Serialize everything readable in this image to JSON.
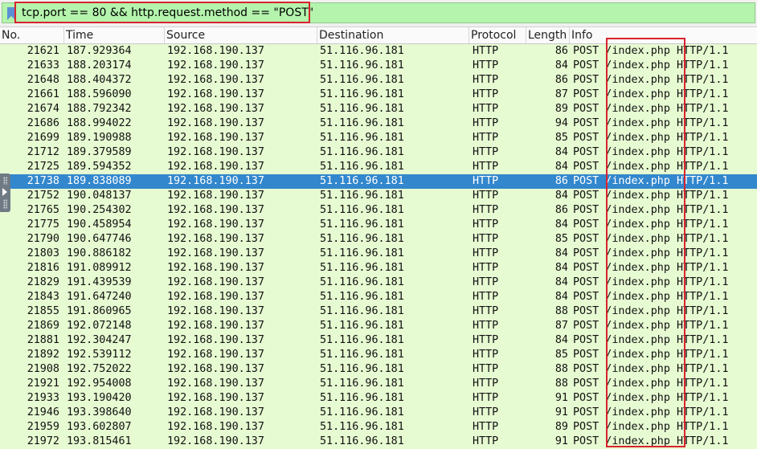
{
  "filter": {
    "text": "tcp.port == 80 && http.request.method == \"POST\""
  },
  "columns": [
    "No.",
    "Time",
    "Source",
    "Destination",
    "Protocol",
    "Length",
    "Info"
  ],
  "packets": [
    {
      "no": "21621",
      "time": "187.929364",
      "src": "192.168.190.137",
      "dst": "51.116.96.181",
      "proto": "HTTP",
      "len": "86",
      "info": "POST /index.php HTTP/1.1"
    },
    {
      "no": "21633",
      "time": "188.203174",
      "src": "192.168.190.137",
      "dst": "51.116.96.181",
      "proto": "HTTP",
      "len": "84",
      "info": "POST /index.php HTTP/1.1"
    },
    {
      "no": "21648",
      "time": "188.404372",
      "src": "192.168.190.137",
      "dst": "51.116.96.181",
      "proto": "HTTP",
      "len": "86",
      "info": "POST /index.php HTTP/1.1"
    },
    {
      "no": "21661",
      "time": "188.596090",
      "src": "192.168.190.137",
      "dst": "51.116.96.181",
      "proto": "HTTP",
      "len": "87",
      "info": "POST /index.php HTTP/1.1"
    },
    {
      "no": "21674",
      "time": "188.792342",
      "src": "192.168.190.137",
      "dst": "51.116.96.181",
      "proto": "HTTP",
      "len": "89",
      "info": "POST /index.php HTTP/1.1"
    },
    {
      "no": "21686",
      "time": "188.994022",
      "src": "192.168.190.137",
      "dst": "51.116.96.181",
      "proto": "HTTP",
      "len": "94",
      "info": "POST /index.php HTTP/1.1"
    },
    {
      "no": "21699",
      "time": "189.190988",
      "src": "192.168.190.137",
      "dst": "51.116.96.181",
      "proto": "HTTP",
      "len": "85",
      "info": "POST /index.php HTTP/1.1"
    },
    {
      "no": "21712",
      "time": "189.379589",
      "src": "192.168.190.137",
      "dst": "51.116.96.181",
      "proto": "HTTP",
      "len": "84",
      "info": "POST /index.php HTTP/1.1"
    },
    {
      "no": "21725",
      "time": "189.594352",
      "src": "192.168.190.137",
      "dst": "51.116.96.181",
      "proto": "HTTP",
      "len": "84",
      "info": "POST /index.php HTTP/1.1"
    },
    {
      "no": "21738",
      "time": "189.838089",
      "src": "192.168.190.137",
      "dst": "51.116.96.181",
      "proto": "HTTP",
      "len": "86",
      "info": "POST /index.php HTTP/1.1",
      "selected": true
    },
    {
      "no": "21752",
      "time": "190.048137",
      "src": "192.168.190.137",
      "dst": "51.116.96.181",
      "proto": "HTTP",
      "len": "84",
      "info": "POST /index.php HTTP/1.1"
    },
    {
      "no": "21765",
      "time": "190.254302",
      "src": "192.168.190.137",
      "dst": "51.116.96.181",
      "proto": "HTTP",
      "len": "86",
      "info": "POST /index.php HTTP/1.1"
    },
    {
      "no": "21775",
      "time": "190.458954",
      "src": "192.168.190.137",
      "dst": "51.116.96.181",
      "proto": "HTTP",
      "len": "84",
      "info": "POST /index.php HTTP/1.1"
    },
    {
      "no": "21790",
      "time": "190.647746",
      "src": "192.168.190.137",
      "dst": "51.116.96.181",
      "proto": "HTTP",
      "len": "85",
      "info": "POST /index.php HTTP/1.1"
    },
    {
      "no": "21803",
      "time": "190.886182",
      "src": "192.168.190.137",
      "dst": "51.116.96.181",
      "proto": "HTTP",
      "len": "84",
      "info": "POST /index.php HTTP/1.1"
    },
    {
      "no": "21816",
      "time": "191.089912",
      "src": "192.168.190.137",
      "dst": "51.116.96.181",
      "proto": "HTTP",
      "len": "84",
      "info": "POST /index.php HTTP/1.1"
    },
    {
      "no": "21829",
      "time": "191.439539",
      "src": "192.168.190.137",
      "dst": "51.116.96.181",
      "proto": "HTTP",
      "len": "84",
      "info": "POST /index.php HTTP/1.1"
    },
    {
      "no": "21843",
      "time": "191.647240",
      "src": "192.168.190.137",
      "dst": "51.116.96.181",
      "proto": "HTTP",
      "len": "84",
      "info": "POST /index.php HTTP/1.1"
    },
    {
      "no": "21855",
      "time": "191.860965",
      "src": "192.168.190.137",
      "dst": "51.116.96.181",
      "proto": "HTTP",
      "len": "88",
      "info": "POST /index.php HTTP/1.1"
    },
    {
      "no": "21869",
      "time": "192.072148",
      "src": "192.168.190.137",
      "dst": "51.116.96.181",
      "proto": "HTTP",
      "len": "87",
      "info": "POST /index.php HTTP/1.1"
    },
    {
      "no": "21881",
      "time": "192.304247",
      "src": "192.168.190.137",
      "dst": "51.116.96.181",
      "proto": "HTTP",
      "len": "84",
      "info": "POST /index.php HTTP/1.1"
    },
    {
      "no": "21892",
      "time": "192.539112",
      "src": "192.168.190.137",
      "dst": "51.116.96.181",
      "proto": "HTTP",
      "len": "85",
      "info": "POST /index.php HTTP/1.1"
    },
    {
      "no": "21908",
      "time": "192.752022",
      "src": "192.168.190.137",
      "dst": "51.116.96.181",
      "proto": "HTTP",
      "len": "88",
      "info": "POST /index.php HTTP/1.1"
    },
    {
      "no": "21921",
      "time": "192.954008",
      "src": "192.168.190.137",
      "dst": "51.116.96.181",
      "proto": "HTTP",
      "len": "88",
      "info": "POST /index.php HTTP/1.1"
    },
    {
      "no": "21933",
      "time": "193.190420",
      "src": "192.168.190.137",
      "dst": "51.116.96.181",
      "proto": "HTTP",
      "len": "91",
      "info": "POST /index.php HTTP/1.1"
    },
    {
      "no": "21946",
      "time": "193.398640",
      "src": "192.168.190.137",
      "dst": "51.116.96.181",
      "proto": "HTTP",
      "len": "91",
      "info": "POST /index.php HTTP/1.1"
    },
    {
      "no": "21959",
      "time": "193.602807",
      "src": "192.168.190.137",
      "dst": "51.116.96.181",
      "proto": "HTTP",
      "len": "89",
      "info": "POST /index.php HTTP/1.1"
    },
    {
      "no": "21972",
      "time": "193.815461",
      "src": "192.168.190.137",
      "dst": "51.116.96.181",
      "proto": "HTTP",
      "len": "91",
      "info": "POST /index.php HTTP/1.1"
    }
  ],
  "colors": {
    "row_bg": "#e7fbd2",
    "selected_bg": "#3287cd",
    "filter_bg": "#b4f4ad",
    "annotation": "#d9232e"
  },
  "icons": {
    "filter_bookmark": "bookmark-icon",
    "side_panel_toggle": "chevron-right-icon"
  }
}
